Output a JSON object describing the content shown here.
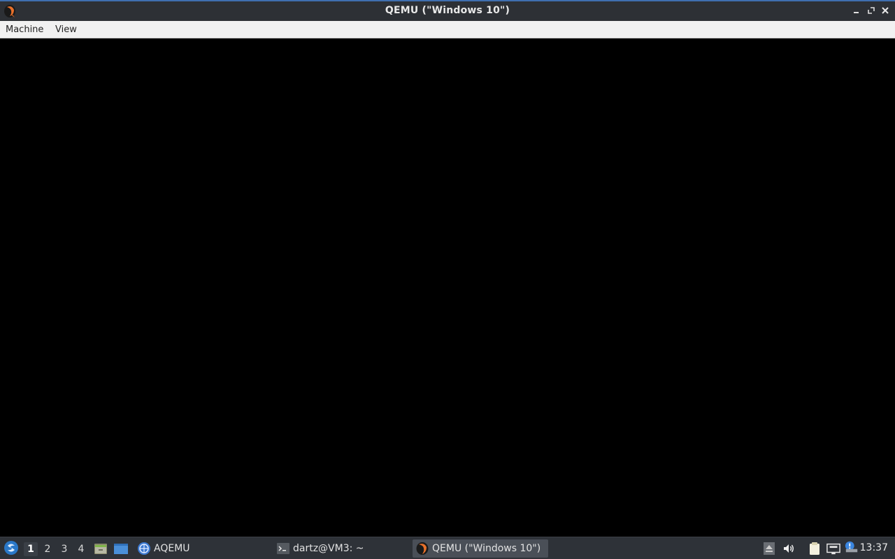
{
  "window": {
    "title": "QEMU (\"Windows 10\")",
    "controls": {
      "minimize": "minimize-icon",
      "restore": "restore-icon",
      "close": "close-icon"
    }
  },
  "menubar": {
    "items": [
      {
        "label": "Machine"
      },
      {
        "label": "View"
      }
    ]
  },
  "taskbar": {
    "desktops": [
      "1",
      "2",
      "3",
      "4"
    ],
    "active_desktop": "1",
    "launchers": [
      {
        "icon": "file-manager-icon"
      },
      {
        "icon": "show-desktop-icon"
      }
    ],
    "tasks": [
      {
        "label": "AQEMU",
        "icon": "aqemu-icon"
      },
      {
        "label": "dartz@VM3: ~",
        "icon": "terminal-icon"
      },
      {
        "label": "QEMU (\"Windows 10\")",
        "icon": "qemu-icon",
        "active": true
      }
    ],
    "tray": [
      "eject-icon",
      "volume-icon",
      "clipboard-icon",
      "network-icon",
      "notification-icon"
    ],
    "clock": "13:37"
  },
  "colors": {
    "titlebar": "#2d3035",
    "accent": "#3f6fb0",
    "menubar": "#f1f1f1",
    "taskbar": "#2e3238",
    "vm_screen": "#000000"
  }
}
